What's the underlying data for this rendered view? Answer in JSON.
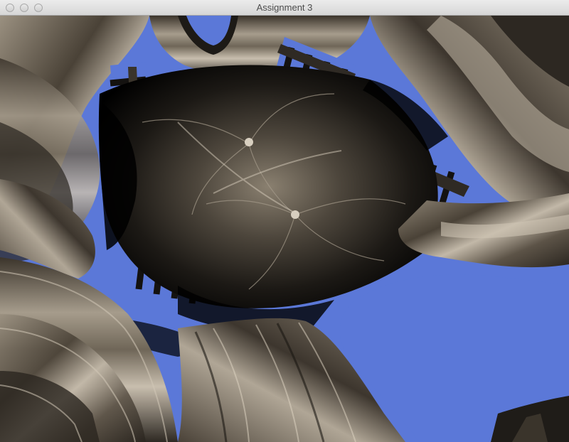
{
  "window": {
    "title": "Assignment 3"
  },
  "colors": {
    "sky": "#5b78d8",
    "stone_dark": "#3a342c",
    "stone_mid": "#7d7365",
    "stone_light": "#b7ad9e",
    "shadow": "#000000"
  },
  "scene": {
    "description_icon": "distorted-cathedral-render"
  }
}
